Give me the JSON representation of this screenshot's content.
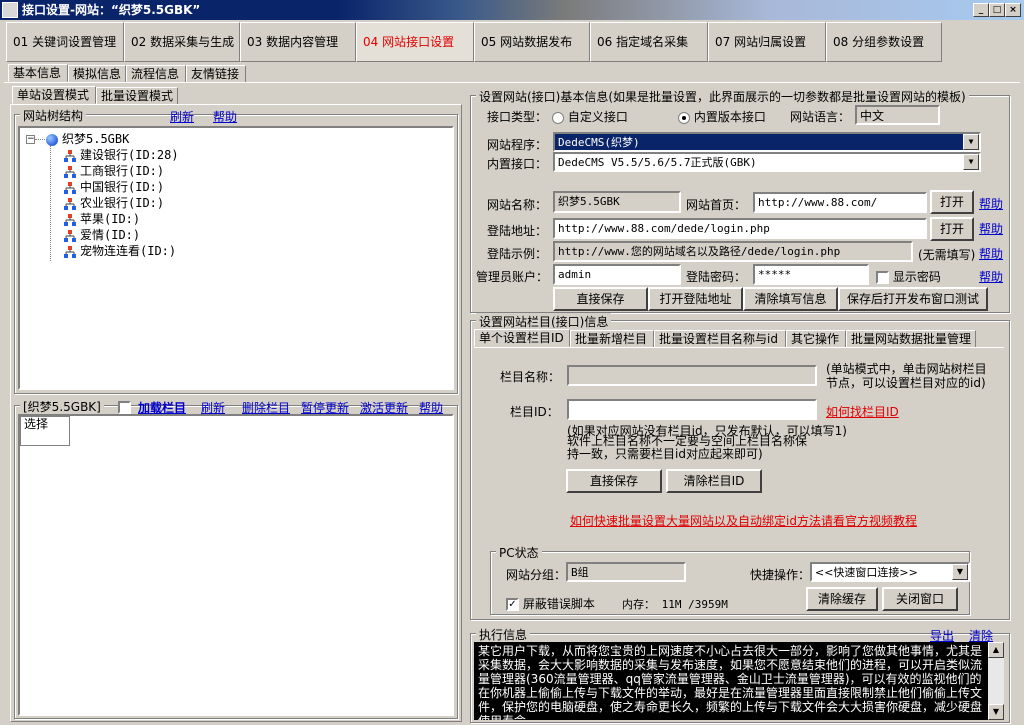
{
  "window": {
    "title": "接口设置-网站：“织梦5.5GBK”",
    "min": "_",
    "max": "□",
    "close": "×"
  },
  "top_tabs": [
    {
      "label": "01 关键词设置管理"
    },
    {
      "label": "02 数据采集与生成"
    },
    {
      "label": "03 数据内容管理"
    },
    {
      "label": "04 网站接口设置"
    },
    {
      "label": "05 网站数据发布"
    },
    {
      "label": "06 指定域名采集"
    },
    {
      "label": "07 网站归属设置"
    },
    {
      "label": "08 分组参数设置"
    }
  ],
  "sub_tabs": [
    "基本信息",
    "模拟信息",
    "流程信息",
    "友情链接"
  ],
  "mode_tabs": [
    "单站设置模式",
    "批量设置模式"
  ],
  "tree": {
    "legend": "网站树结构",
    "refresh": "刷新",
    "help": "帮助",
    "root": "织梦5.5GBK",
    "items": [
      "建设银行(ID:28)",
      "工商银行(ID:)",
      "中国银行(ID:)",
      "农业银行(ID:)",
      "苹果(ID:)",
      "爱情(ID:)",
      "宠物连连看(ID:)"
    ]
  },
  "column_bar": {
    "legend": "[织梦5.5GBK]",
    "load": "加载栏目",
    "refresh": "刷新",
    "delete": "删除栏目",
    "pause": "暂停更新",
    "activate": "激活更新",
    "help": "帮助",
    "list_item": "选择"
  },
  "basic": {
    "legend": "设置网站(接口)基本信息(如果是批量设置，此界面展示的一切参数都是批量设置网站的模板)",
    "iface_type_label": "接口类型：",
    "radio_custom": "自定义接口",
    "radio_builtin": "内置版本接口",
    "lang_label": "网站语言：",
    "lang_value": "中文",
    "program_label": "网站程序：",
    "program_value": "DedeCMS(织梦)",
    "builtin_label": "内置接口：",
    "builtin_value": "DedeCMS V5.5/5.6/5.7正式版(GBK)",
    "name_label": "网站名称：",
    "name_value": "织梦5.5GBK",
    "home_label": "网站首页：",
    "home_value": "http://www.88.com/",
    "open": "打开",
    "help": "帮助",
    "login_label": "登陆地址：",
    "login_value": "http://www.88.com/dede/login.php",
    "example_label": "登陆示例：",
    "example_value": "http://www.您的网站域名以及路径/dede/login.php",
    "no_fill": "(无需填写)",
    "admin_label": "管理员账户：",
    "admin_value": "admin",
    "pwd_label": "登陆密码：",
    "pwd_value": "*****",
    "show_pwd": "显示密码",
    "btn_save": "直接保存",
    "btn_open_login": "打开登陆地址",
    "btn_clear": "清除填写信息",
    "btn_save_test": "保存后打开发布窗口测试"
  },
  "column": {
    "legend": "设置网站栏目(接口)信息",
    "tabs": [
      "单个设置栏目ID",
      "批量新增栏目",
      "批量设置栏目名称与id",
      "其它操作",
      "批量网站数据批量管理"
    ],
    "name_label": "栏目名称：",
    "name_hint": "(单站模式中，单击网站树栏目节点，可以设置栏目对应的id)",
    "id_label": "栏目ID：",
    "find_id": "如何找栏目ID",
    "note1": "(如果对应网站没有栏目id，只发布默认，可以填写1)",
    "note2": "软件上栏目名称不一定要与空间上栏目名称保持一致，只需要栏目id对应起来即可)",
    "btn_save": "直接保存",
    "btn_clear": "清除栏目ID",
    "tutorial": "如何快速批量设置大量网站以及自动绑定id方法请看官方视频教程"
  },
  "pc": {
    "legend": "PC状态",
    "group_label": "网站分组：",
    "group_value": "B组",
    "quick_label": "快捷操作：",
    "quick_value": "<<快速窗口连接>>",
    "mask_errors": "屏蔽错误脚本",
    "memory": "内存： 11M /3959M",
    "btn_clear_cache": "清除缓存",
    "btn_close": "关闭窗口"
  },
  "log": {
    "legend": "执行信息",
    "export": "导出",
    "clear": "清除",
    "text": "某它用户下载，从而将您宝贵的上网速度不小心占去很大一部分，影响了您做其他事情，尤其是采集数据，会大大影响数据的采集与发布速度，如果您不愿意结束他们的进程，可以开启类似流量管理器(360流量管理器、qq管家流量管理器、金山卫士流量管理器)，可以有效的监视他们的在你机器上偷偷上传与下载文件的举动，最好是在流量管理器里面直接限制禁止他们偷偷上传文件，保护您的电脑硬盘，使之寿命更长久，频繁的上传与下载文件会大大损害你硬盘，减少硬盘使用寿命。"
  },
  "colors": {
    "title_bar": "#0a246a",
    "active_tab_text": "#e00000",
    "link": "#0000cc",
    "highlight": "#0a246a"
  }
}
